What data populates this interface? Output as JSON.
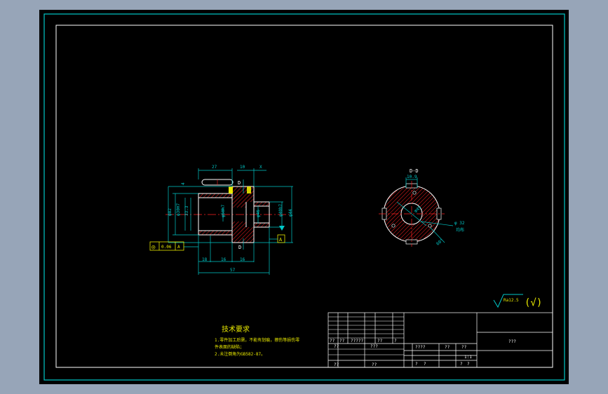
{
  "colors": {
    "background": "#97a5b8",
    "canvas": "#000000",
    "frame": "#00c8c8",
    "dimension": "#00c8c8",
    "outline": "#ffffff",
    "hatch": "#ff2020",
    "center_line": "#ff2020",
    "note_text": "#e8e800",
    "symbol": "#e8e800"
  },
  "side_view": {
    "dims": {
      "top_a": "27",
      "top_b": "10",
      "top_x": "X",
      "left_4": "4",
      "slot_d": "D",
      "diam_outer": "φ82",
      "diam_bore": "φ30H7",
      "diam_key": "33.3",
      "diam_mid": "φ50h7",
      "diam_shaft": "φ46",
      "diam_right_1": "φ40h7",
      "diam_right_2": "φ44",
      "bottom_a": "18",
      "bottom_b": "16",
      "bottom_c": "16",
      "total": "57"
    },
    "section_d_bottom": "D",
    "tolerance_frame": {
      "symbol": "◎",
      "value": "0.06",
      "datum": "A"
    },
    "datum_label": "A"
  },
  "end_view": {
    "title": "D-D",
    "dims": {
      "top": "10.9",
      "hole": "φ45",
      "pcd": "φ 32",
      "pcd_note": "均布",
      "angle": "60°"
    }
  },
  "roughness": {
    "value": "Ra12.5",
    "paren": "(√)"
  },
  "notes": {
    "title": "技术要求",
    "lines": [
      "1.零件加工后需，不能有划痕，擦伤等损伤零",
      "件表面的缺陷；",
      "2.未注倒角为GB582-87。"
    ]
  },
  "title_block": {
    "name_cell": "???",
    "row1": [
      "??",
      "??",
      "?????",
      "??",
      "?"
    ],
    "row2": [
      "??",
      "???"
    ],
    "row2_right": [
      "????",
      "??",
      "??"
    ],
    "row3": [
      "??",
      "??"
    ],
    "row3_right": [
      "?",
      "?",
      "?",
      "?"
    ],
    "scale": "1:1"
  }
}
